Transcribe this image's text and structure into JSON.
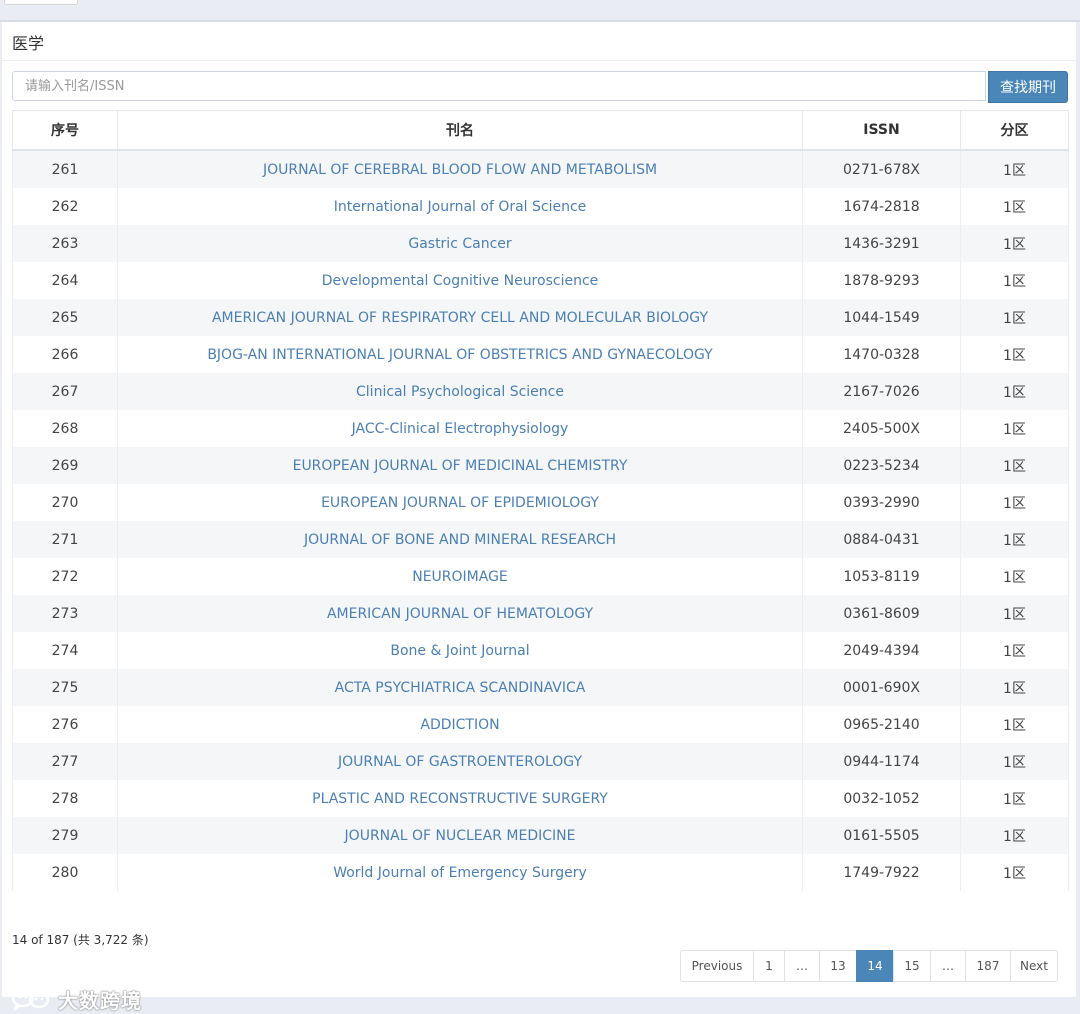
{
  "panel": {
    "title": "医学",
    "search": {
      "placeholder": "请输入刊名/ISSN",
      "value": "",
      "button_label": "查找期刊"
    }
  },
  "table": {
    "headers": {
      "seq": "序号",
      "name": "刊名",
      "issn": "ISSN",
      "rank": "分区"
    },
    "rows": [
      {
        "seq": "261",
        "name": "JOURNAL OF CEREBRAL BLOOD FLOW AND METABOLISM",
        "issn": "0271-678X",
        "rank": "1区"
      },
      {
        "seq": "262",
        "name": "International Journal of Oral Science",
        "issn": "1674-2818",
        "rank": "1区"
      },
      {
        "seq": "263",
        "name": "Gastric Cancer",
        "issn": "1436-3291",
        "rank": "1区"
      },
      {
        "seq": "264",
        "name": "Developmental Cognitive Neuroscience",
        "issn": "1878-9293",
        "rank": "1区"
      },
      {
        "seq": "265",
        "name": "AMERICAN JOURNAL OF RESPIRATORY CELL AND MOLECULAR BIOLOGY",
        "issn": "1044-1549",
        "rank": "1区"
      },
      {
        "seq": "266",
        "name": "BJOG-AN INTERNATIONAL JOURNAL OF OBSTETRICS AND GYNAECOLOGY",
        "issn": "1470-0328",
        "rank": "1区"
      },
      {
        "seq": "267",
        "name": "Clinical Psychological Science",
        "issn": "2167-7026",
        "rank": "1区"
      },
      {
        "seq": "268",
        "name": "JACC-Clinical Electrophysiology",
        "issn": "2405-500X",
        "rank": "1区"
      },
      {
        "seq": "269",
        "name": "EUROPEAN JOURNAL OF MEDICINAL CHEMISTRY",
        "issn": "0223-5234",
        "rank": "1区"
      },
      {
        "seq": "270",
        "name": "EUROPEAN JOURNAL OF EPIDEMIOLOGY",
        "issn": "0393-2990",
        "rank": "1区"
      },
      {
        "seq": "271",
        "name": "JOURNAL OF BONE AND MINERAL RESEARCH",
        "issn": "0884-0431",
        "rank": "1区"
      },
      {
        "seq": "272",
        "name": "NEUROIMAGE",
        "issn": "1053-8119",
        "rank": "1区"
      },
      {
        "seq": "273",
        "name": "AMERICAN JOURNAL OF HEMATOLOGY",
        "issn": "0361-8609",
        "rank": "1区"
      },
      {
        "seq": "274",
        "name": "Bone & Joint Journal",
        "issn": "2049-4394",
        "rank": "1区"
      },
      {
        "seq": "275",
        "name": "ACTA PSYCHIATRICA SCANDINAVICA",
        "issn": "0001-690X",
        "rank": "1区"
      },
      {
        "seq": "276",
        "name": "ADDICTION",
        "issn": "0965-2140",
        "rank": "1区"
      },
      {
        "seq": "277",
        "name": "JOURNAL OF GASTROENTEROLOGY",
        "issn": "0944-1174",
        "rank": "1区"
      },
      {
        "seq": "278",
        "name": "PLASTIC AND RECONSTRUCTIVE SURGERY",
        "issn": "0032-1052",
        "rank": "1区"
      },
      {
        "seq": "279",
        "name": "JOURNAL OF NUCLEAR MEDICINE",
        "issn": "0161-5505",
        "rank": "1区"
      },
      {
        "seq": "280",
        "name": "World Journal of Emergency Surgery",
        "issn": "1749-7922",
        "rank": "1区"
      }
    ]
  },
  "pagination": {
    "summary": "14 of 187 (共 3,722 条)",
    "pages": [
      {
        "label": "Previous",
        "kind": "prev",
        "active": false
      },
      {
        "label": "1",
        "kind": "page",
        "active": false
      },
      {
        "label": "…",
        "kind": "ellipsis",
        "active": false
      },
      {
        "label": "13",
        "kind": "page",
        "active": false
      },
      {
        "label": "14",
        "kind": "page",
        "active": true
      },
      {
        "label": "15",
        "kind": "page",
        "active": false
      },
      {
        "label": "…",
        "kind": "ellipsis",
        "active": false
      },
      {
        "label": "187",
        "kind": "page",
        "active": false
      },
      {
        "label": "Next",
        "kind": "next",
        "active": false
      }
    ]
  },
  "watermark": {
    "text": "大数跨境",
    "icon": "wechat-logo-icon"
  },
  "colors": {
    "accent": "#4a86b8",
    "link": "#4c7fb4",
    "stripe": "#f5f6f8"
  }
}
